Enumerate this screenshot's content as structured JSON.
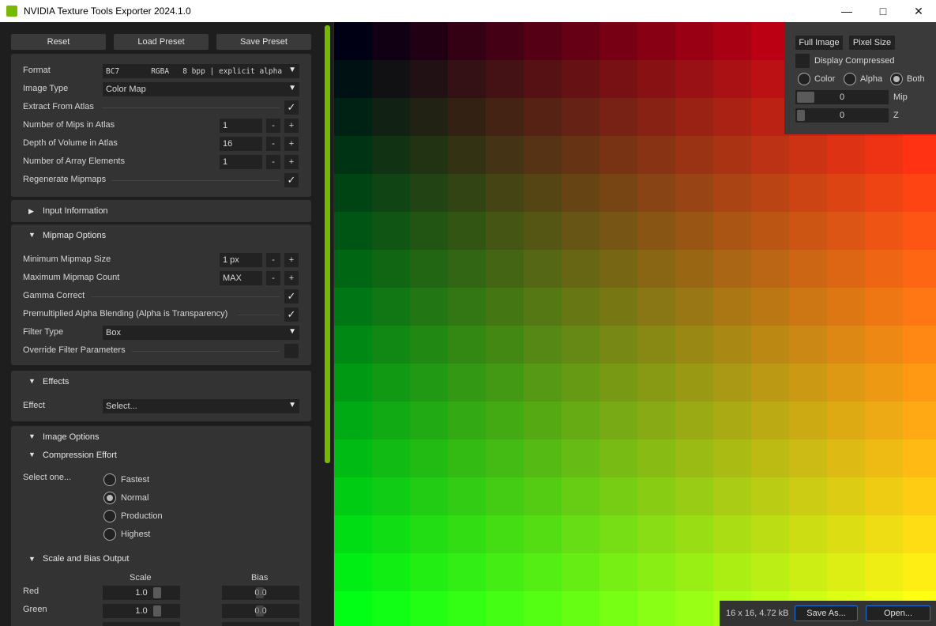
{
  "window": {
    "title": "NVIDIA Texture Tools Exporter 2024.1.0"
  },
  "toolbar": {
    "reset": "Reset",
    "load_preset": "Load Preset",
    "save_preset": "Save Preset"
  },
  "settings": {
    "format": {
      "label": "Format",
      "value": "BC7       RGBA   8 bpp | explicit alpha"
    },
    "image_type": {
      "label": "Image Type",
      "value": "Color Map"
    },
    "extract_atlas": {
      "label": "Extract From Atlas",
      "checked": true
    },
    "mips_atlas": {
      "label": "Number of Mips in Atlas",
      "value": "1"
    },
    "depth_atlas": {
      "label": "Depth of Volume in Atlas",
      "value": "16"
    },
    "array_elements": {
      "label": "Number of Array Elements",
      "value": "1"
    },
    "regen_mips": {
      "label": "Regenerate Mipmaps",
      "checked": true
    }
  },
  "stepper": {
    "minus": "-",
    "plus": "+"
  },
  "sections": {
    "input_info": "Input Information",
    "mipmap_options": "Mipmap Options",
    "effects": "Effects",
    "image_options": "Image Options",
    "compression_effort": "Compression Effort",
    "scale_bias": "Scale and Bias Output"
  },
  "mipmap": {
    "min_size": {
      "label": "Minimum Mipmap Size",
      "value": "1 px"
    },
    "max_count": {
      "label": "Maximum Mipmap Count",
      "value": "MAX"
    },
    "gamma": {
      "label": "Gamma Correct",
      "checked": true
    },
    "premult": {
      "label": "Premultiplied Alpha Blending (Alpha is Transparency)",
      "checked": true
    },
    "filter_type": {
      "label": "Filter Type",
      "value": "Box"
    },
    "override": {
      "label": "Override Filter Parameters",
      "checked": false
    }
  },
  "effects": {
    "label": "Effect",
    "value": "Select..."
  },
  "compression": {
    "prompt": "Select one...",
    "options": [
      "Fastest",
      "Normal",
      "Production",
      "Highest"
    ],
    "selected": "Normal"
  },
  "scale_bias": {
    "scale_header": "Scale",
    "bias_header": "Bias",
    "rows": [
      {
        "channel": "Red",
        "scale": "1.0",
        "bias": "0.0"
      },
      {
        "channel": "Green",
        "scale": "1.0",
        "bias": "0.0"
      }
    ]
  },
  "viewer": {
    "full_image": "Full Image",
    "pixel_size": "Pixel Size",
    "display_compressed": "Display Compressed",
    "channels": [
      "Color",
      "Alpha",
      "Both"
    ],
    "selected_channel": "Both",
    "mip_value": "0",
    "mip_label": "Mip",
    "z_value": "0",
    "z_label": "Z"
  },
  "footer": {
    "info": "16 x 16, 4.72 kB",
    "save_as": "Save As...",
    "open": "Open..."
  },
  "colors": {
    "accent": "#76b900",
    "focus_border": "#1e6cd8"
  }
}
